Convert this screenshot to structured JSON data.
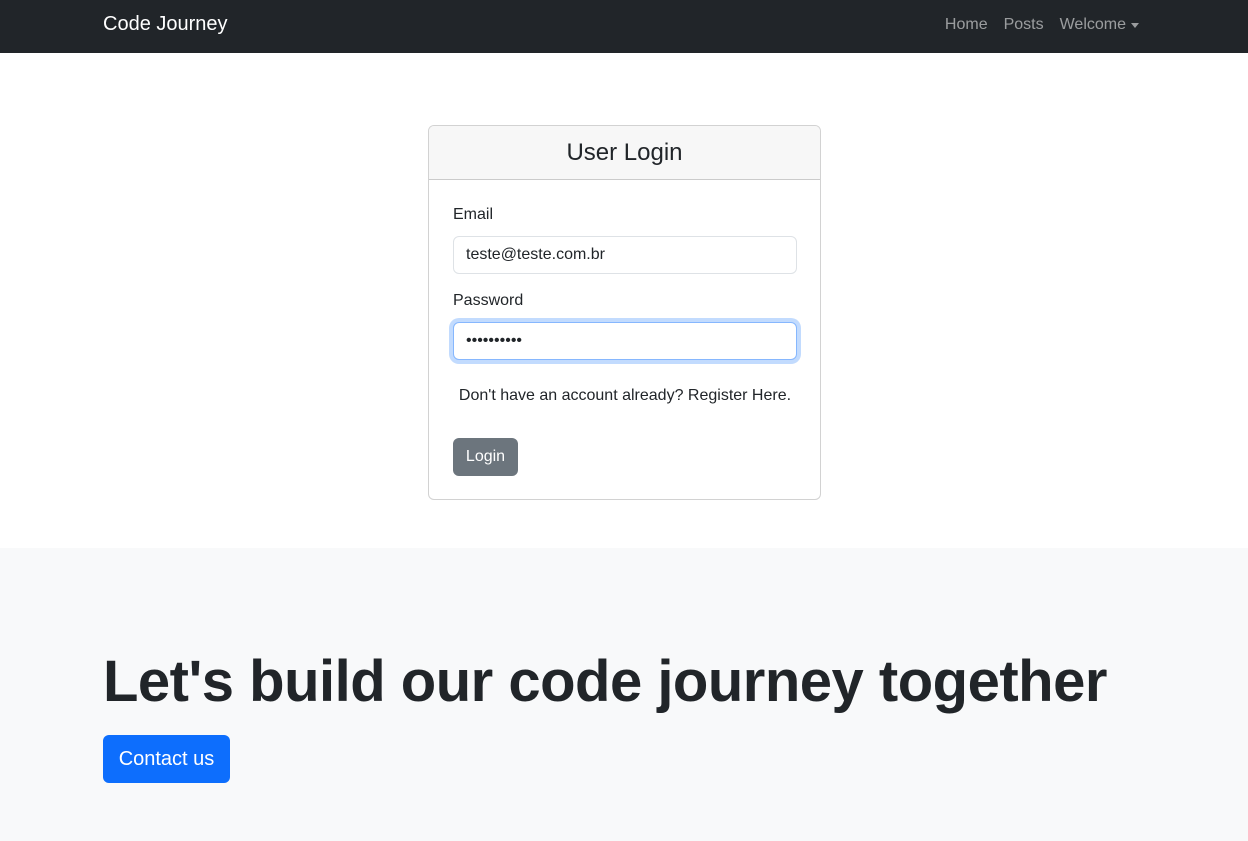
{
  "navbar": {
    "brand": "Code Journey",
    "links": [
      "Home",
      "Posts",
      "Welcome"
    ]
  },
  "login_card": {
    "title": "User Login",
    "email_label": "Email",
    "email_value": "teste@teste.com.br",
    "password_label": "Password",
    "password_value": "••••••••••",
    "register_text": "Don't have an account already? Register Here.",
    "login_button": "Login"
  },
  "hero": {
    "title": "Let's build our code journey together",
    "contact_button": "Contact us"
  },
  "colors": {
    "navbar_bg": "#212529",
    "primary": "#0d6efd",
    "secondary": "#6c757d",
    "hero_bg": "#f8f9fa"
  }
}
